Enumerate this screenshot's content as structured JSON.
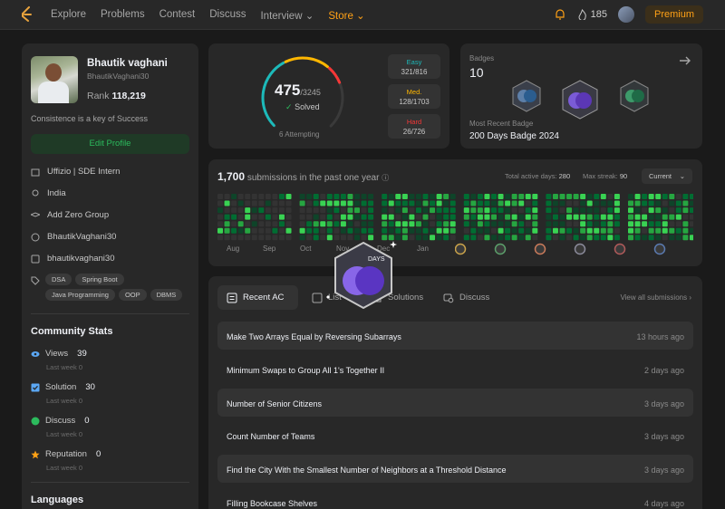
{
  "nav": {
    "links": [
      "Explore",
      "Problems",
      "Contest",
      "Discuss",
      "Interview",
      "Store"
    ],
    "streak": "185",
    "premium": "Premium"
  },
  "profile": {
    "name": "Bhautik vaghani",
    "username": "BhautikVaghani30",
    "rank_label": "Rank",
    "rank_value": "118,219",
    "motto": "Consistence is a key of Success",
    "edit_button": "Edit Profile",
    "company": "Uffizio | SDE Intern",
    "location": "India",
    "group": "Add Zero Group",
    "github": "BhautikVaghani30",
    "linkedin": "bhautikvaghani30",
    "skills": [
      "DSA",
      "Spring Boot",
      "Java Programming",
      "OOP",
      "DBMS"
    ]
  },
  "community": {
    "title": "Community Stats",
    "stats": [
      {
        "label": "Views",
        "value": "39",
        "sub": "Last week",
        "subval": "0",
        "color": "#5ba8f5"
      },
      {
        "label": "Solution",
        "value": "30",
        "sub": "Last week",
        "subval": "0",
        "color": "#5ba8f5"
      },
      {
        "label": "Discuss",
        "value": "0",
        "sub": "Last week",
        "subval": "0",
        "color": "#2cbb5d"
      },
      {
        "label": "Reputation",
        "value": "0",
        "sub": "Last week",
        "subval": "0",
        "color": "#ffa116"
      }
    ],
    "languages_title": "Languages"
  },
  "solved": {
    "count": "475",
    "total": "/3245",
    "label": "Solved",
    "attempting": "6 Attempting",
    "solved_fraction": 0.146,
    "difficulty": [
      {
        "label": "Easy",
        "value": "321/816",
        "color": "#1cbaba"
      },
      {
        "label": "Med.",
        "value": "128/1703",
        "color": "#ffb700"
      },
      {
        "label": "Hard",
        "value": "26/726",
        "color": "#f63737"
      }
    ]
  },
  "badges": {
    "title": "Badges",
    "count": "10",
    "recent_label": "Most Recent Badge",
    "recent_value": "200 Days Badge 2024"
  },
  "heatmap": {
    "count": "1,700",
    "label": "submissions in the past one year",
    "active_label": "Total active days:",
    "active_value": "280",
    "streak_label": "Max streak:",
    "streak_value": "90",
    "range": "Current",
    "months": [
      "Aug",
      "Sep",
      "Oct",
      "Nov",
      "Dec",
      "Jan"
    ]
  },
  "recent": {
    "tabs": [
      "Recent AC",
      "List",
      "Solutions",
      "Discuss"
    ],
    "view_all": "View all submissions",
    "items": [
      {
        "title": "Make Two Arrays Equal by Reversing Subarrays",
        "time": "13 hours ago"
      },
      {
        "title": "Minimum Swaps to Group All 1's Together II",
        "time": "2 days ago"
      },
      {
        "title": "Number of Senior Citizens",
        "time": "3 days ago"
      },
      {
        "title": "Count Number of Teams",
        "time": "3 days ago"
      },
      {
        "title": "Find the City With the Smallest Number of Neighbors at a Threshold Distance",
        "time": "3 days ago"
      },
      {
        "title": "Filling Bookcase Shelves",
        "time": "4 days ago"
      }
    ]
  },
  "overlay_badge": {
    "label": "DAYS"
  }
}
